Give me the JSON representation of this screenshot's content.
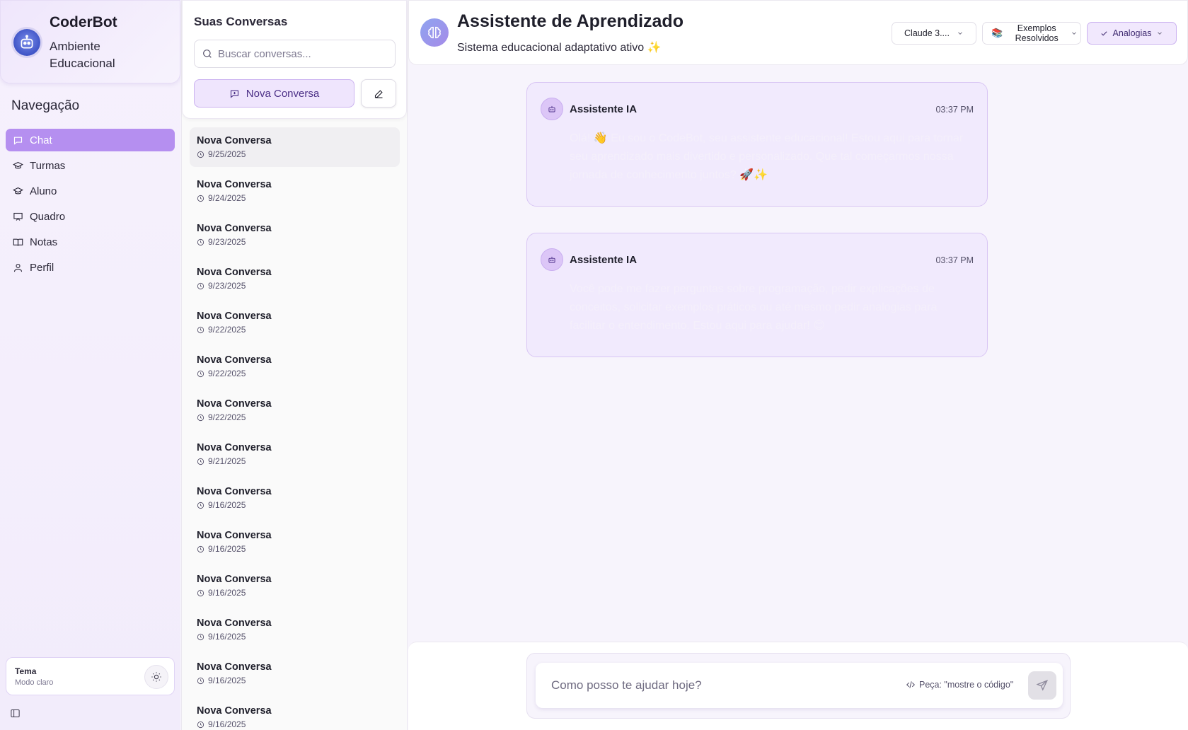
{
  "brand": {
    "title": "CoderBot",
    "subtitle": "Ambiente Educacional",
    "logo_icon": "robot-avatar-icon"
  },
  "nav": {
    "heading": "Navegação",
    "items": [
      {
        "label": "Chat",
        "icon": "chat-icon",
        "active": true
      },
      {
        "label": "Turmas",
        "icon": "graduation-cap-icon",
        "active": false
      },
      {
        "label": "Aluno",
        "icon": "graduation-cap-icon",
        "active": false
      },
      {
        "label": "Quadro",
        "icon": "board-icon",
        "active": false
      },
      {
        "label": "Notas",
        "icon": "book-icon",
        "active": false
      },
      {
        "label": "Perfil",
        "icon": "user-icon",
        "active": false
      }
    ],
    "theme": {
      "title": "Tema",
      "mode": "Modo claro",
      "icon": "sun-icon"
    }
  },
  "conversations": {
    "title": "Suas Conversas",
    "search_placeholder": "Buscar conversas...",
    "new_label": "Nova Conversa",
    "items": [
      {
        "name": "Nova Conversa",
        "date": "9/25/2025"
      },
      {
        "name": "Nova Conversa",
        "date": "9/24/2025"
      },
      {
        "name": "Nova Conversa",
        "date": "9/23/2025"
      },
      {
        "name": "Nova Conversa",
        "date": "9/23/2025"
      },
      {
        "name": "Nova Conversa",
        "date": "9/22/2025"
      },
      {
        "name": "Nova Conversa",
        "date": "9/22/2025"
      },
      {
        "name": "Nova Conversa",
        "date": "9/22/2025"
      },
      {
        "name": "Nova Conversa",
        "date": "9/21/2025"
      },
      {
        "name": "Nova Conversa",
        "date": "9/16/2025"
      },
      {
        "name": "Nova Conversa",
        "date": "9/16/2025"
      },
      {
        "name": "Nova Conversa",
        "date": "9/16/2025"
      },
      {
        "name": "Nova Conversa",
        "date": "9/16/2025"
      },
      {
        "name": "Nova Conversa",
        "date": "9/16/2025"
      },
      {
        "name": "Nova Conversa",
        "date": "9/16/2025"
      }
    ]
  },
  "header": {
    "title": "Assistente de Aprendizado",
    "subtitle": "Sistema educacional adaptativo ativo ✨",
    "model": "Claude 3....",
    "examples_line1": "Exemplos",
    "examples_line2": "Resolvidos",
    "analogies": "Analogias"
  },
  "messages": [
    {
      "author": "Assistente IA",
      "time": "03:37 PM",
      "text": "Olá! 👋 Eu sou o CodeBot, seu assistente educacional! Estou aqui para tornar seu aprendizado mais divertido e personalizado. Que tal começarmos nossa jornada de conhecimento juntos? 🚀✨"
    },
    {
      "author": "Assistente IA",
      "time": "03:37 PM",
      "text": "Você pode me fazer perguntas sobre programação, pedir explicações de conceitos, solicitar exemplos práticos ou até mesmo pedir analogias para facilitar o entendimento. Estou aqui para ajudar! 😊"
    }
  ],
  "composer": {
    "placeholder": "Como posso te ajudar hoje?",
    "hint": "Peça: \"mostre o código\""
  }
}
